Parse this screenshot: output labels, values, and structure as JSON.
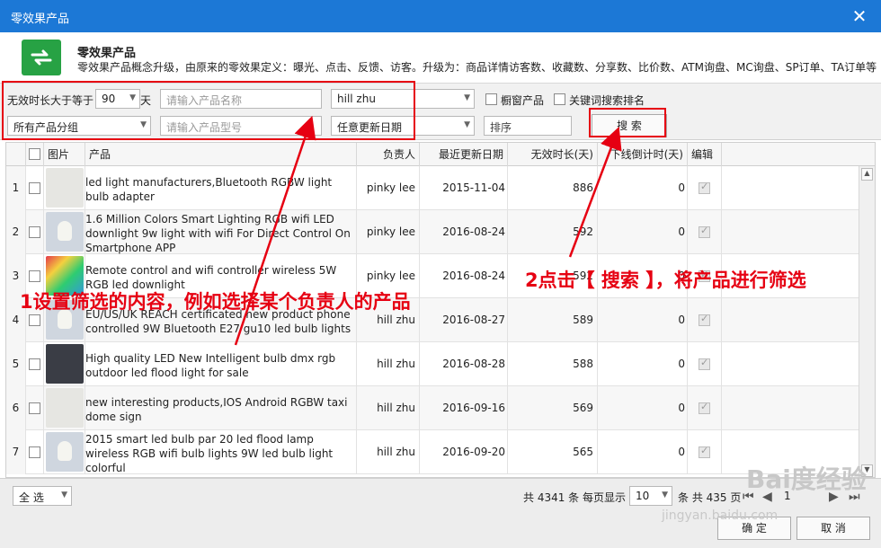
{
  "window": {
    "title": "零效果产品",
    "close": "✕"
  },
  "header": {
    "title": "零效果产品",
    "desc": "零效果产品概念升级，由原来的零效果定义：曝光、点击、反馈、访客。升级为：商品详情访客数、收藏数、分享数、比价数、ATM询盘、MC询盘、SP订单、TA订单等"
  },
  "filters": {
    "duration_label": "无效时长大于等于",
    "duration_value": "90",
    "duration_unit": "天",
    "name_placeholder": "请输入产品名称",
    "owner_value": "hill zhu",
    "window_product": "橱窗产品",
    "keyword_rank": "关键词搜索排名",
    "group_value": "所有产品分组",
    "model_placeholder": "请输入产品型号",
    "date_value": "任意更新日期",
    "sort_value": "排序",
    "search_label": "搜 索"
  },
  "table": {
    "headers": [
      "图片",
      "产品",
      "负责人",
      "最近更新日期",
      "无效时长(天)",
      "下线倒计时(天)",
      "编辑"
    ],
    "rows": [
      {
        "num": "1",
        "name": "led light manufacturers,Bluetooth RGBW light bulb adapter",
        "owner": "pinky lee",
        "date": "2015-11-04",
        "duration": "886",
        "countdown": "0",
        "thumb": "light"
      },
      {
        "num": "2",
        "name": "1.6 Million Colors Smart Lighting RGB wifi LED downlight 9w light with wifi For Direct Control On Smartphone APP",
        "owner": "pinky lee",
        "date": "2016-08-24",
        "duration": "592",
        "countdown": "0",
        "thumb": "bulb"
      },
      {
        "num": "3",
        "name": "Remote control and wifi controller wireless 5W RGB led downlight",
        "owner": "pinky lee",
        "date": "2016-08-24",
        "duration": "592",
        "countdown": "0",
        "thumb": "color"
      },
      {
        "num": "4",
        "name": "EU/US/UK REACH certificated new product phone controlled 9W Bluetooth E27 gu10 led bulb lights",
        "owner": "hill zhu",
        "date": "2016-08-27",
        "duration": "589",
        "countdown": "0",
        "thumb": "bulb"
      },
      {
        "num": "5",
        "name": "High quality LED New Intelligent bulb dmx rgb outdoor led flood light for sale",
        "owner": "hill zhu",
        "date": "2016-08-28",
        "duration": "588",
        "countdown": "0",
        "thumb": "dark"
      },
      {
        "num": "6",
        "name": "new interesting products,IOS Android RGBW taxi dome sign",
        "owner": "hill zhu",
        "date": "2016-09-16",
        "duration": "569",
        "countdown": "0",
        "thumb": "light"
      },
      {
        "num": "7",
        "name": "2015 smart led bulb par 20 led flood lamp wireless RGB wifi bulb lights 9W led bulb light colorful",
        "owner": "hill zhu",
        "date": "2016-09-20",
        "duration": "565",
        "countdown": "0",
        "thumb": "bulb"
      }
    ]
  },
  "footer": {
    "select_all": "全 选",
    "total": "共 4341 条",
    "per_page_label": "每页显示",
    "per_page": "10",
    "pages": "条 共 435 页",
    "page_num": "1",
    "ok": "确 定",
    "cancel": "取 消"
  },
  "annotations": {
    "step1": "1设置筛选的内容，例如选择某个负责人的产品",
    "step2": "2点击【 搜索 】，将产品进行筛选",
    "color": "#e60012"
  },
  "watermark": {
    "brand": "Bai度经验",
    "url": "jingyan.baidu.com"
  }
}
